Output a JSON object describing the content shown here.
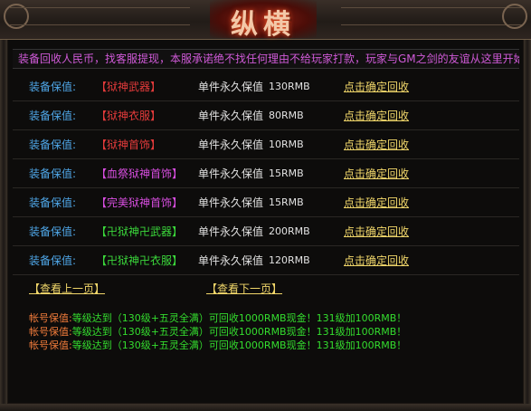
{
  "header": {
    "logo_text": "纵横"
  },
  "notice": "装备回收人民币，找客服提现，本服承诺绝不找任何理由不给玩家打款，玩家与GM之剑的友谊从这里开始",
  "rows": [
    {
      "label": "装备保值:",
      "item": "【狱神武器】",
      "item_color": "#e43b3b",
      "desc": "单件永久保值",
      "price": "130RMB",
      "action": "点击确定回收"
    },
    {
      "label": "装备保值:",
      "item": "【狱神衣服】",
      "item_color": "#e43b3b",
      "desc": "单件永久保值",
      "price": "80RMB",
      "action": "点击确定回收"
    },
    {
      "label": "装备保值:",
      "item": "【狱神首饰】",
      "item_color": "#e43b3b",
      "desc": "单件永久保值",
      "price": "10RMB",
      "action": "点击确定回收"
    },
    {
      "label": "装备保值:",
      "item": "【血祭狱神首饰】",
      "item_color": "#d84ee0",
      "desc": "单件永久保值",
      "price": "15RMB",
      "action": "点击确定回收"
    },
    {
      "label": "装备保值:",
      "item": "【完美狱神首饰】",
      "item_color": "#d84ee0",
      "desc": "单件永久保值",
      "price": "15RMB",
      "action": "点击确定回收"
    },
    {
      "label": "装备保值:",
      "item": "【卍狱神卍武器】",
      "item_color": "#3bd83b",
      "desc": "单件永久保值",
      "price": "200RMB",
      "action": "点击确定回收"
    },
    {
      "label": "装备保值:",
      "item": "【卍狱神卍衣服】",
      "item_color": "#3bd83b",
      "desc": "单件永久保值",
      "price": "120RMB",
      "action": "点击确定回收"
    }
  ],
  "pager": {
    "prev": "【查看上一页】",
    "next": "【查看下一页】"
  },
  "account": [
    {
      "key": "帐号保值:",
      "value": "等级达到（130级+五灵全满）可回收1000RMB现金！131级加100RMB！"
    },
    {
      "key": "帐号保值:",
      "value": "等级达到（130级+五灵全满）可回收1000RMB现金！131级加100RMB！"
    },
    {
      "key": "帐号保值:",
      "value": "等级达到（130级+五灵全满）可回收1000RMB现金！131级加100RMB！"
    }
  ]
}
